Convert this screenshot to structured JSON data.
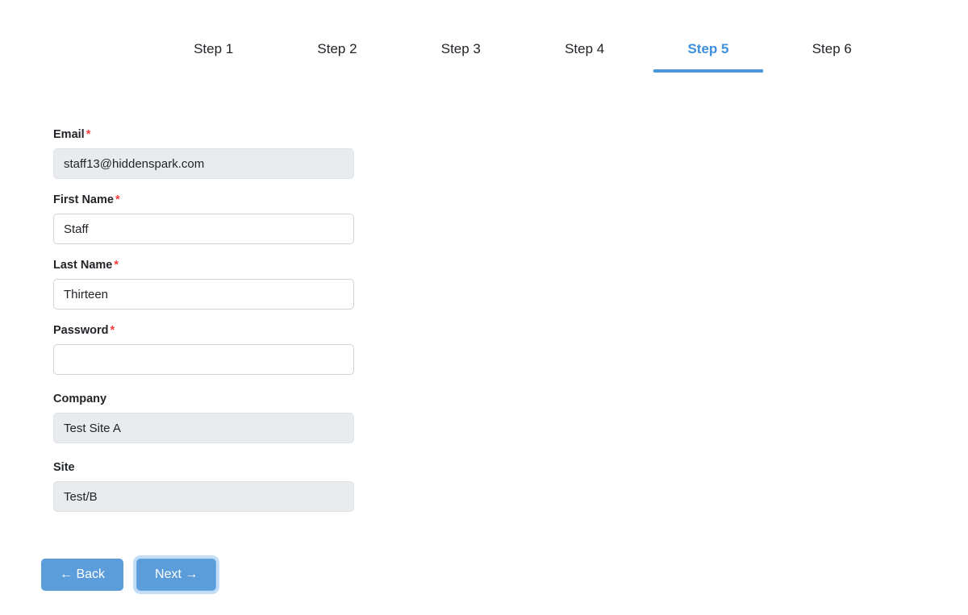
{
  "wizard": {
    "steps": [
      {
        "label": "Step 1",
        "active": false
      },
      {
        "label": "Step 2",
        "active": false
      },
      {
        "label": "Step 3",
        "active": false
      },
      {
        "label": "Step 4",
        "active": false
      },
      {
        "label": "Step 5",
        "active": true
      },
      {
        "label": "Step 6",
        "active": false
      }
    ],
    "active_step_label": "Step 5",
    "accent_color": "#4b96d8",
    "active_text_color": "#3d8fdd"
  },
  "form": {
    "required_marker": "*",
    "fields": {
      "email": {
        "label": "Email",
        "required": true,
        "value": "staff13@hiddenspark.com",
        "placeholder": "",
        "disabled": true
      },
      "first_name": {
        "label": "First Name",
        "required": true,
        "value": "Staff",
        "placeholder": "",
        "disabled": false
      },
      "last_name": {
        "label": "Last Name",
        "required": true,
        "value": "Thirteen",
        "placeholder": "",
        "disabled": false
      },
      "password": {
        "label": "Password",
        "required": true,
        "value": "",
        "placeholder": "",
        "disabled": false
      },
      "company": {
        "label": "Company",
        "required": false,
        "value": "Test Site A",
        "placeholder": "",
        "disabled": true
      },
      "site": {
        "label": "Site",
        "required": false,
        "value": "Test/B",
        "placeholder": "",
        "disabled": true
      }
    }
  },
  "footer": {
    "back_label": "Back",
    "next_label": "Next",
    "back_arrow": "←",
    "next_arrow": "→",
    "button_color": "#5b9ddb",
    "focused_button": "Next"
  }
}
